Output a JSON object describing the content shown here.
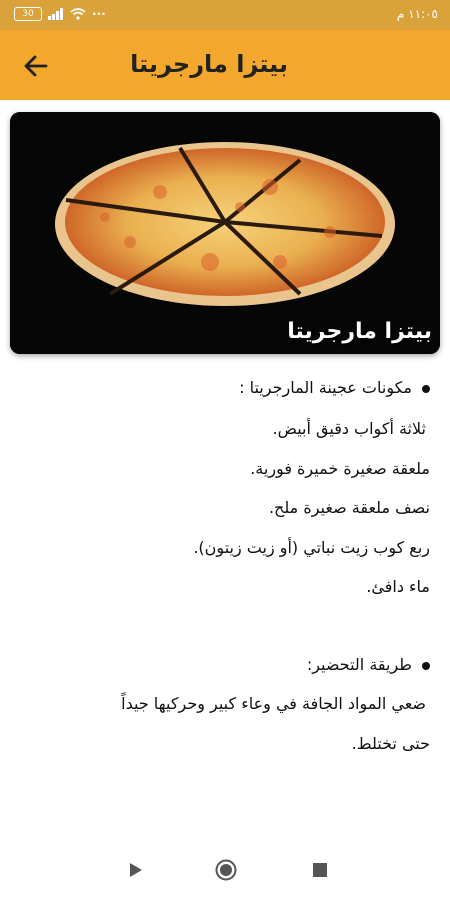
{
  "status_bar": {
    "battery": "30",
    "time": "١١:٠٥ م"
  },
  "app_bar": {
    "title": "بيتزا مارجريتا",
    "back_icon": "arrow-left-icon"
  },
  "hero": {
    "caption": "بيتزا مارجريتا"
  },
  "content": {
    "lines": [
      "مكونات عجينة المارجريتا :",
      "ثلاثة أكواب دقيق أبيض.",
      "ملعقة صغيرة خميرة فورية.",
      "نصف ملعقة صغيرة ملح.",
      "ربع كوب زيت نباتي (أو زيت زيتون).",
      "ماء دافئ.",
      "طريقة التحضير:",
      "ضعي المواد الجافة في وعاء كبير وحركيها جيداً",
      "حتى تختلط."
    ]
  },
  "nav_bar": {
    "back_icon": "triangle-play-icon",
    "home_icon": "circle-home-icon",
    "recents_icon": "square-recents-icon"
  },
  "colors": {
    "status_bar": "#d9a23b",
    "app_bar": "#f4a72d"
  }
}
